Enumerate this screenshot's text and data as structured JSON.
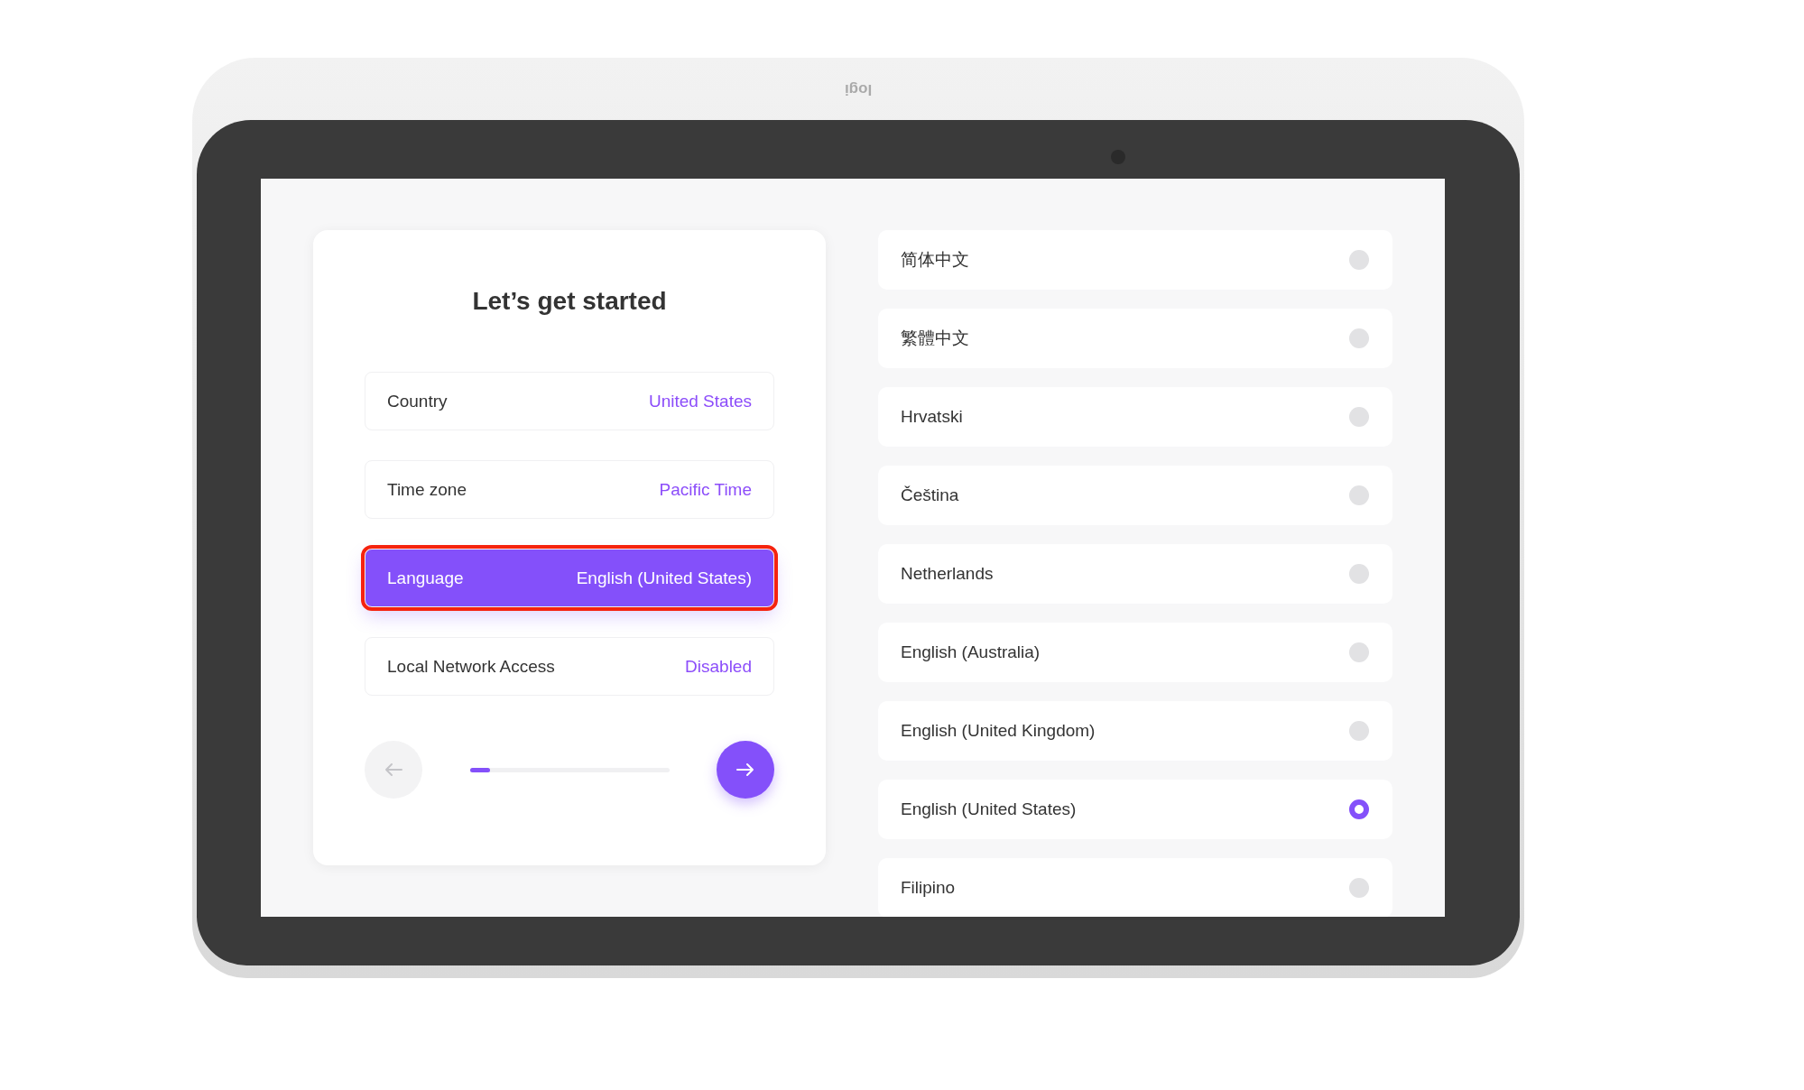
{
  "device": {
    "logo": "logi"
  },
  "setup_card": {
    "title": "Let’s get started",
    "settings": [
      {
        "label": "Country",
        "value": "United States",
        "selected": false,
        "outlined": false
      },
      {
        "label": "Time zone",
        "value": "Pacific Time",
        "selected": false,
        "outlined": false
      },
      {
        "label": "Language",
        "value": "English (United States)",
        "selected": true,
        "outlined": true
      },
      {
        "label": "Local Network Access",
        "value": "Disabled",
        "selected": false,
        "outlined": false
      }
    ],
    "back_disabled": true,
    "progress": {
      "level": 0.1
    }
  },
  "languages": [
    {
      "label": "简体中文",
      "selected": false
    },
    {
      "label": "繁體中文",
      "selected": false
    },
    {
      "label": "Hrvatski",
      "selected": false
    },
    {
      "label": "Čeština",
      "selected": false
    },
    {
      "label": "Netherlands",
      "selected": false
    },
    {
      "label": "English (Australia)",
      "selected": false
    },
    {
      "label": "English (United Kingdom)",
      "selected": false
    },
    {
      "label": "English (United States)",
      "selected": true
    },
    {
      "label": "Filipino",
      "selected": false
    }
  ]
}
